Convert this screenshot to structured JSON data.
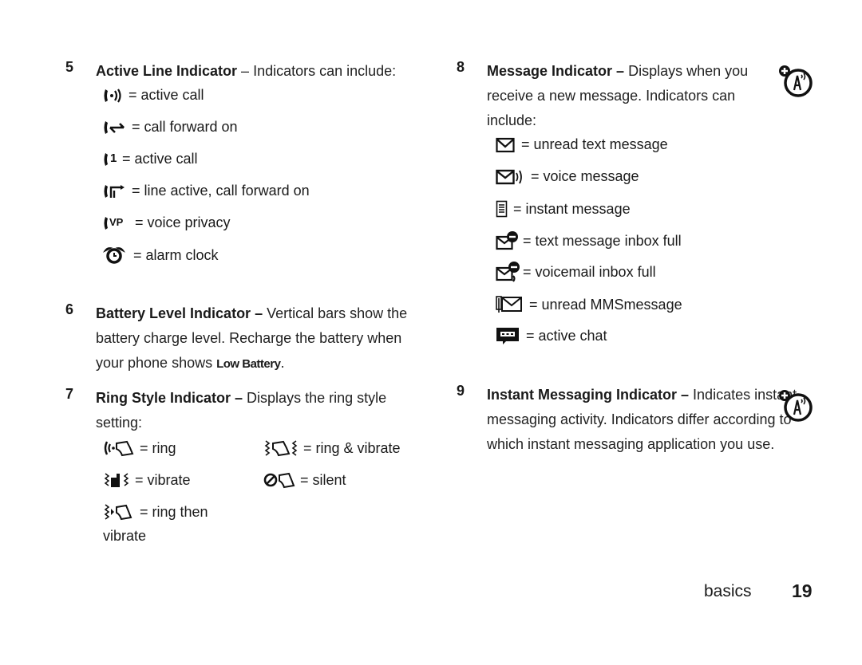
{
  "sections": {
    "s5": {
      "number": "5",
      "title": "Active Line Indicator",
      "dash": " – ",
      "intro": "Indicators can include:",
      "items": [
        {
          "icon": "active-call-signal-icon",
          "label": "= active call"
        },
        {
          "icon": "call-forward-icon",
          "label": "= call forward on"
        },
        {
          "icon": "active-call-line1-icon",
          "label": "= active call"
        },
        {
          "icon": "line-active-call-forward-icon",
          "label": "= line active, call forward on"
        },
        {
          "icon": "voice-privacy-icon",
          "label": "= voice privacy",
          "glyph_text": "VP"
        },
        {
          "icon": "alarm-clock-icon",
          "label": "= alarm clock"
        }
      ]
    },
    "s6": {
      "number": "6",
      "title": "Battery Level Indicator –",
      "text_a": " Vertical bars show the battery charge level. Recharge the battery when your phone shows ",
      "display_text": "Low Battery",
      "text_b": "."
    },
    "s7": {
      "number": "7",
      "title": "Ring Style Indicator –",
      "intro": " Displays the ring style setting:",
      "items": [
        {
          "icon": "ring-icon",
          "label": "= ring"
        },
        {
          "icon": "ring-and-vibrate-icon",
          "label": "= ring & vibrate"
        },
        {
          "icon": "vibrate-icon",
          "label": "= vibrate"
        },
        {
          "icon": "silent-icon",
          "label": "= silent"
        },
        {
          "icon": "ring-then-vibrate-icon",
          "label": "= ring then",
          "label_cont": "vibrate"
        }
      ]
    },
    "s8": {
      "number": "8",
      "title": "Message Indicator –",
      "intro": " Displays when you receive a new message. Indicators can include:",
      "items": [
        {
          "icon": "unread-text-message-icon",
          "label": "= unread text message"
        },
        {
          "icon": "voice-message-icon",
          "label": "= voice message"
        },
        {
          "icon": "instant-message-icon",
          "label": "= instant message"
        },
        {
          "icon": "text-inbox-full-icon",
          "label": "= text message inbox full"
        },
        {
          "icon": "voicemail-inbox-full-icon",
          "label": "= voicemail inbox full"
        },
        {
          "icon": "unread-mms-icon",
          "label": "= unread MMSmessage"
        },
        {
          "icon": "active-chat-icon",
          "label": "= active chat"
        }
      ]
    },
    "s9": {
      "number": "9",
      "title": "Instant Messaging Indicator –",
      "intro": " Indicates instant messaging activity. Indicators differ according to which instant messaging application you use."
    }
  },
  "badges": {
    "network_feature_icon": "network-dependent-feature-icon"
  },
  "footer": {
    "section_label": "basics",
    "page_number": "19"
  }
}
